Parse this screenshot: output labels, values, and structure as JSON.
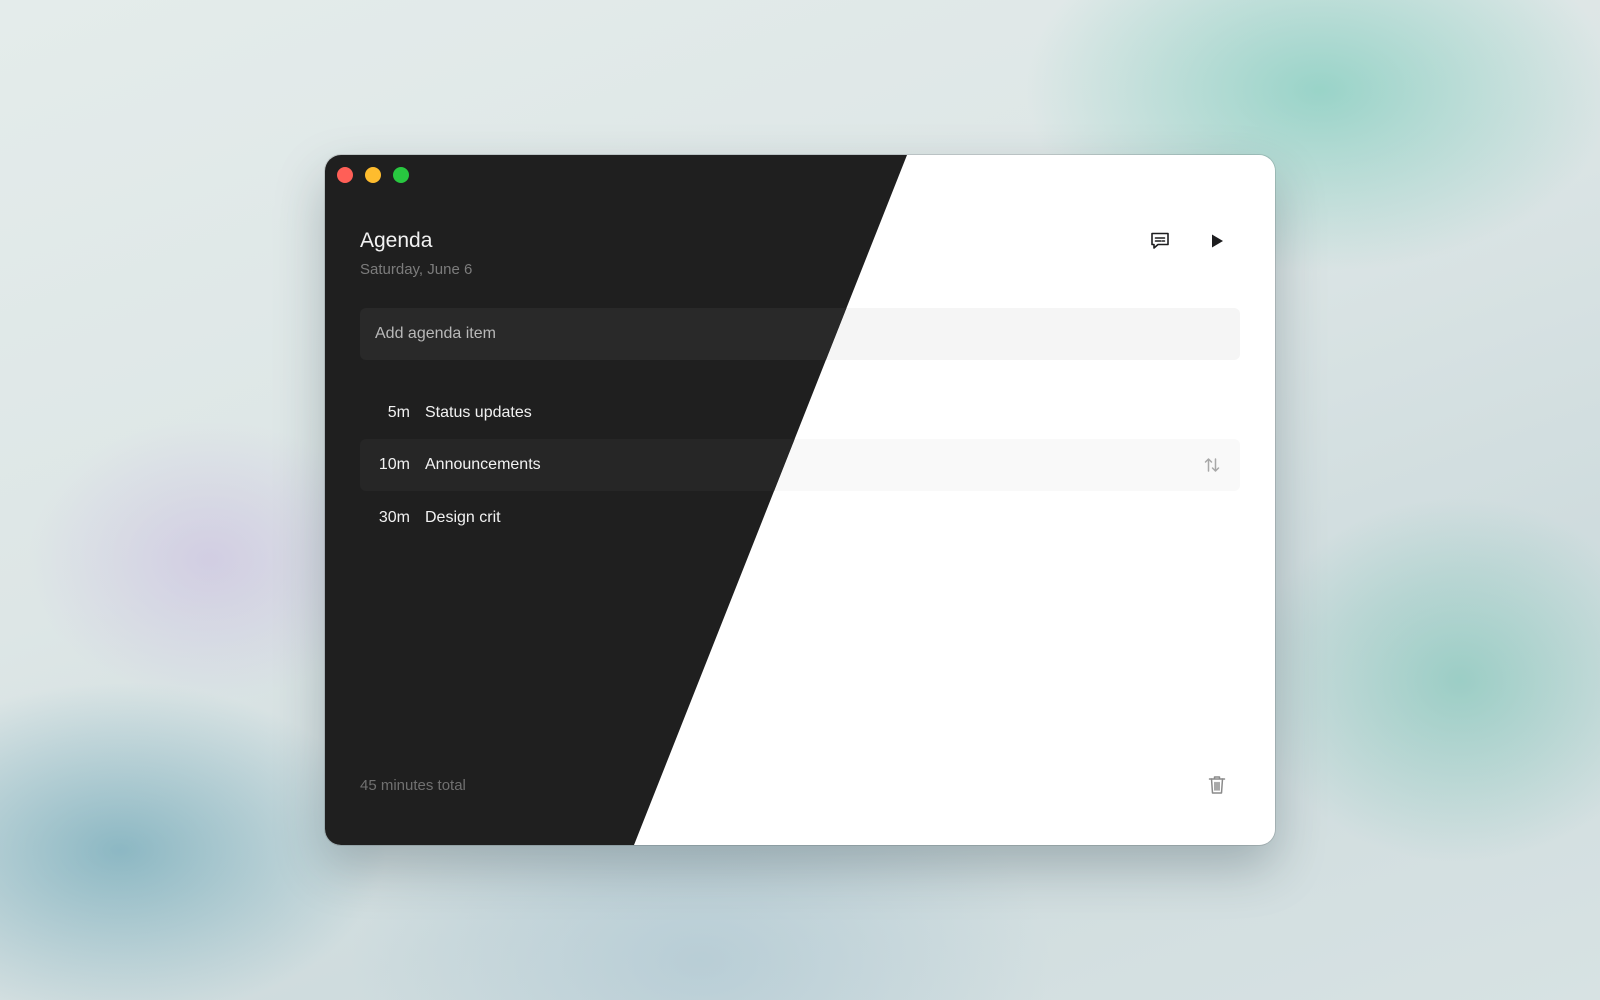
{
  "agenda": {
    "title": "Agenda",
    "date": "Saturday, June 6",
    "add_placeholder": "Add agenda item",
    "items": [
      {
        "duration": "5m",
        "label": "Status updates"
      },
      {
        "duration": "10m",
        "label": "Announcements"
      },
      {
        "duration": "30m",
        "label": "Design crit"
      }
    ],
    "total": "45 minutes total"
  },
  "icons": {
    "captions": "captions-icon",
    "play": "play-icon",
    "reorder": "reorder-arrows-icon",
    "trash": "trash-icon"
  },
  "colors": {
    "close": "#ff5f57",
    "minimize": "#febc2e",
    "zoom": "#28c840",
    "dark_surface": "#1f1f1f",
    "light_surface": "#ffffff"
  }
}
